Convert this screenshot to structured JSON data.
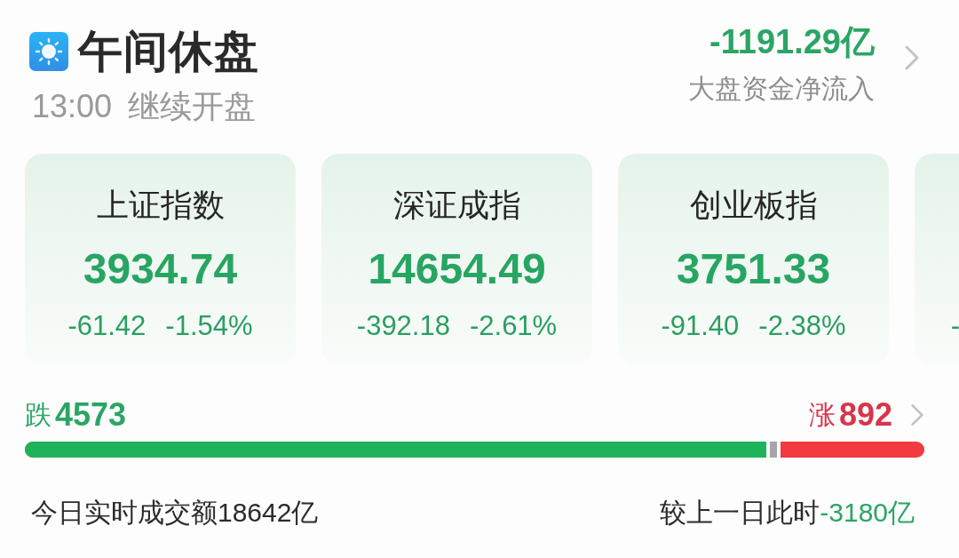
{
  "header": {
    "title": "午间休盘",
    "resume_time": "13:00",
    "resume_label": "继续开盘",
    "net_flow": {
      "value": "-1191.29亿",
      "label": "大盘资金净流入"
    }
  },
  "indices": [
    {
      "name": "上证指数",
      "value": "3934.74",
      "change": "-61.42",
      "change_pct": "-1.54%"
    },
    {
      "name": "深证成指",
      "value": "14654.49",
      "change": "-392.18",
      "change_pct": "-2.61%"
    },
    {
      "name": "创业板指",
      "value": "3751.33",
      "change": "-91.40",
      "change_pct": "-2.38%"
    },
    {
      "change": "-"
    }
  ],
  "breadth": {
    "down": {
      "label": "跌",
      "count": "4573"
    },
    "up": {
      "label": "涨",
      "count": "892"
    },
    "bar": {
      "level": 0.84
    }
  },
  "turnover": {
    "text": "今日实时成交额18642亿",
    "compare_label": "较上一日此时",
    "compare_value": "-3180亿"
  }
}
